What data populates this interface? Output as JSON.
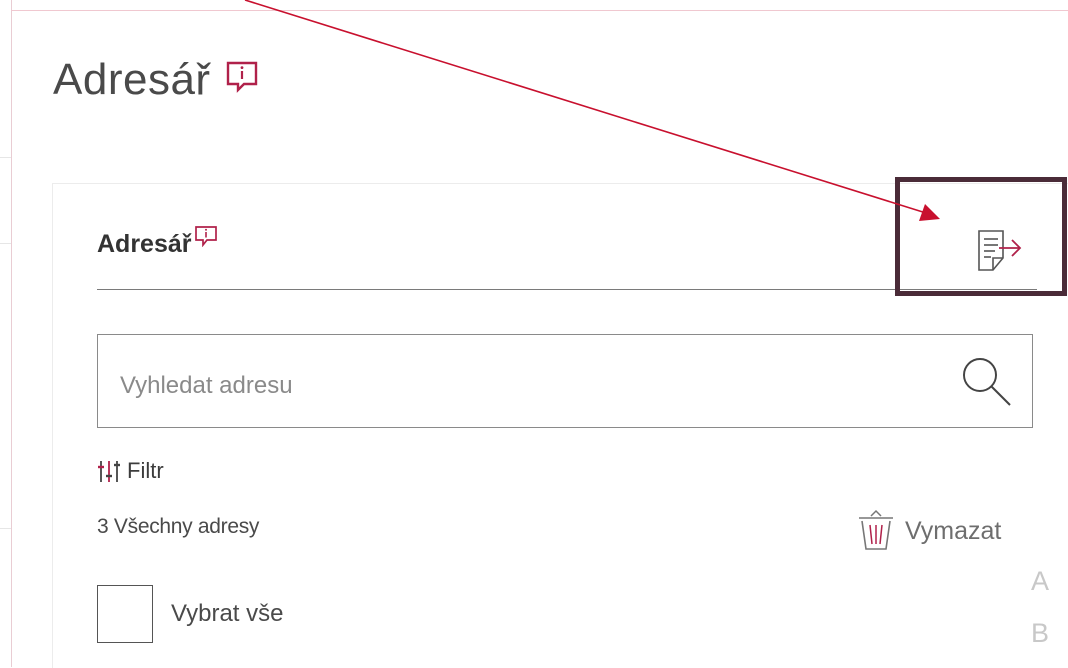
{
  "page": {
    "title": "Adresář"
  },
  "section": {
    "title": "Adresář"
  },
  "search": {
    "placeholder": "Vyhledat adresu",
    "value": ""
  },
  "filter": {
    "label": "Filtr"
  },
  "addresses": {
    "count_label": "3 Všechny adresy"
  },
  "actions": {
    "clear_label": "Vymazat",
    "select_all_label": "Vybrat vše"
  },
  "alphabet_index": [
    "A",
    "B"
  ],
  "icons": {
    "page_info": "info-speech-icon",
    "section_info": "info-speech-icon",
    "export": "export-list-icon",
    "search": "search-icon",
    "filter": "filter-sliders-icon",
    "clear": "trash-icon"
  },
  "colors": {
    "accent": "#b0214a",
    "annotation_arrow": "#c8102e",
    "highlight_box": "#4a2b38",
    "text_primary": "#3c3c3c",
    "placeholder": "#8a8a8a"
  }
}
